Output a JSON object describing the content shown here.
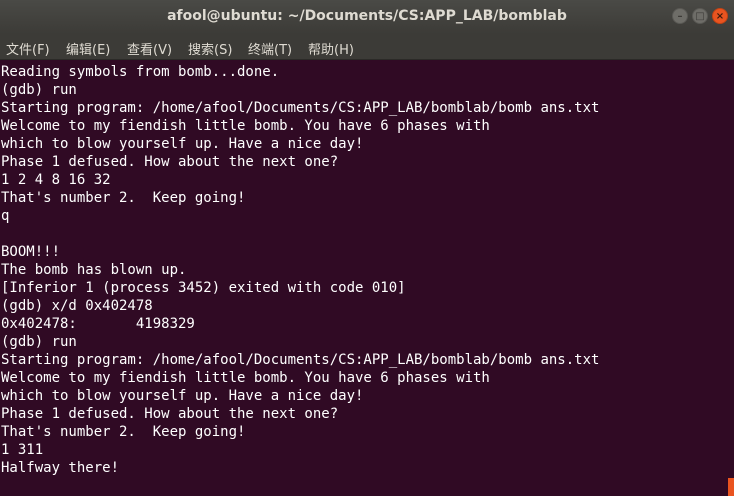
{
  "window": {
    "title": "afool@ubuntu: ~/Documents/CS:APP_LAB/bomblab",
    "buttons": {
      "minimize": "–",
      "maximize": "□",
      "close": "×"
    }
  },
  "menu": {
    "items": [
      {
        "label": "文件(F)"
      },
      {
        "label": "编辑(E)"
      },
      {
        "label": "查看(V)"
      },
      {
        "label": "搜索(S)"
      },
      {
        "label": "终端(T)"
      },
      {
        "label": "帮助(H)"
      }
    ]
  },
  "terminal": {
    "lines": [
      "Reading symbols from bomb...done.",
      "(gdb) run",
      "Starting program: /home/afool/Documents/CS:APP_LAB/bomblab/bomb ans.txt",
      "Welcome to my fiendish little bomb. You have 6 phases with",
      "which to blow yourself up. Have a nice day!",
      "Phase 1 defused. How about the next one?",
      "1 2 4 8 16 32",
      "That's number 2.  Keep going!",
      "q",
      "",
      "BOOM!!!",
      "The bomb has blown up.",
      "[Inferior 1 (process 3452) exited with code 010]",
      "(gdb) x/d 0x402478",
      "0x402478:       4198329",
      "(gdb) run",
      "Starting program: /home/afool/Documents/CS:APP_LAB/bomblab/bomb ans.txt",
      "Welcome to my fiendish little bomb. You have 6 phases with",
      "which to blow yourself up. Have a nice day!",
      "Phase 1 defused. How about the next one?",
      "That's number 2.  Keep going!",
      "1 311",
      "Halfway there!"
    ]
  },
  "colors": {
    "terminal_bg": "#300a24",
    "terminal_fg": "#ffffff",
    "titlebar_bg": "#3c3b37",
    "accent": "#e95420"
  }
}
